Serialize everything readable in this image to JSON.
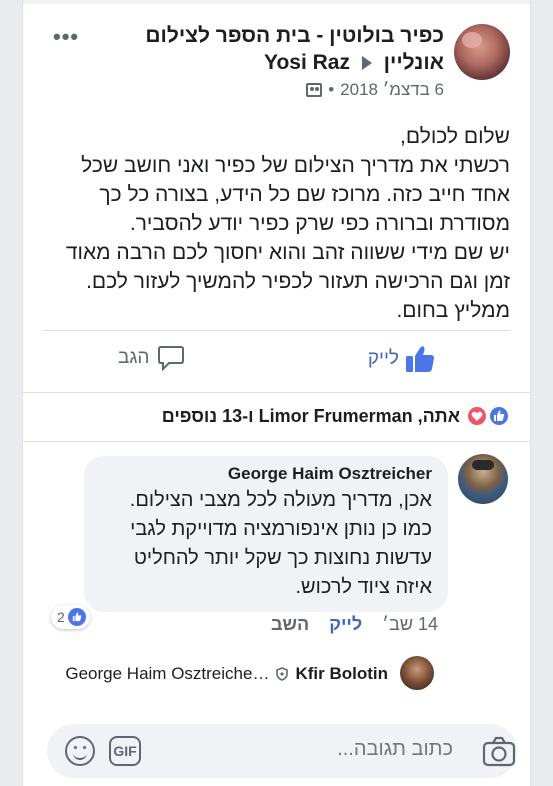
{
  "post": {
    "title_line1": "כפיר בולוטין - בית הספר לצילום",
    "title_line2_page": "אונליין",
    "title_line2_user": "Yosi Raz",
    "date": "6 בדצמ׳ 2018",
    "meta_separator": "•",
    "more": "•••",
    "body": [
      "שלום לכולם,",
      "רכשתי את מדריך הצילום של כפיר ואני חושב שכל אחד חייב כזה. מרוכז שם כל הידע, בצורה כל כך מסודרת וברורה כפי שרק כפיר יודע להסביר.",
      "יש שם מידי ששווה זהב והוא יחסוך לכם הרבה מאוד זמן וגם הרכישה תעזור לכפיר להמשיך לעזור לכם. ממליץ בחום."
    ]
  },
  "actions": {
    "like_label": "לייק",
    "comment_label": "הגב"
  },
  "reactions": {
    "text": "אתה, Limor Frumerman ו-13 נוספים"
  },
  "comment": {
    "author": "George Haim Osztreicher",
    "text": "אכן, מדריך מעולה לכל מצבי הצילום. כמו כן נותן אינפורמציה מדוייקת לגבי עדשות נחוצות כך שקל יותר להחליט איזה ציוד לרכוש.",
    "reaction_count": "2",
    "time": "14 שב׳",
    "like_label": "לייק",
    "reply_label": "השב"
  },
  "reply_preview": {
    "author": "Kfir Bolotin",
    "preview": "George Haim Osztreiche…"
  },
  "composer": {
    "placeholder": "כתוב תגובה...",
    "gif_label": "GIF"
  },
  "colors": {
    "accent": "#4267b2",
    "like_reaction": "#4a76e8",
    "love_reaction": "#f25268",
    "bubble": "#f0f2f5",
    "secondary_text": "#606770"
  },
  "icons": {
    "post_avatar": "avatar",
    "audience": "group-icon",
    "like": "thumbs-up-icon",
    "comment": "speech-bubble-icon",
    "reaction_like": "thumbs-up-icon",
    "reaction_love": "heart-icon",
    "verified": "shield-icon",
    "camera": "camera-icon",
    "gif": "gif-icon",
    "emoji": "smiley-icon"
  }
}
